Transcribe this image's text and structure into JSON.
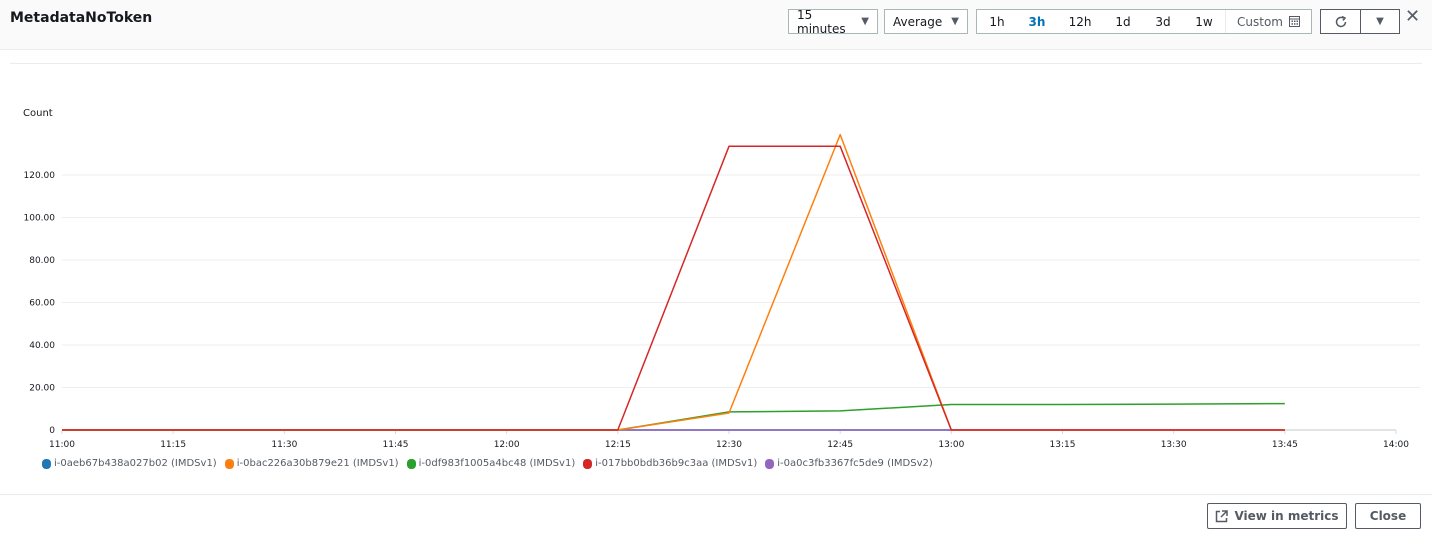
{
  "header": {
    "title": "MetadataNoToken",
    "period": "15 minutes",
    "statistic": "Average",
    "ranges": [
      "1h",
      "3h",
      "12h",
      "1d",
      "3d",
      "1w"
    ],
    "active_range": "3h",
    "custom_label": "Custom",
    "icons": {
      "calendar": "calendar-icon",
      "refresh": "refresh-icon",
      "dropdown": "chevron-down-icon",
      "close": "close-icon"
    }
  },
  "footer": {
    "view_in_metrics": "View in metrics",
    "close": "Close"
  },
  "chart_data": {
    "type": "line",
    "title": "",
    "ylabel": "Count",
    "xlabel": "",
    "ylim": [
      0,
      140
    ],
    "yticks": [
      0,
      20,
      40,
      60,
      80,
      100,
      120
    ],
    "ytick_labels": [
      "0",
      "20.00",
      "40.00",
      "60.00",
      "80.00",
      "100.00",
      "120.00"
    ],
    "x": [
      "11:00",
      "11:15",
      "11:30",
      "11:45",
      "12:00",
      "12:15",
      "12:30",
      "12:45",
      "13:00",
      "13:15",
      "13:30",
      "13:45"
    ],
    "xtick_labels": [
      "11:00",
      "11:15",
      "11:30",
      "11:45",
      "12:00",
      "12:15",
      "12:30",
      "12:45",
      "13:00",
      "13:15",
      "13:30",
      "13:45",
      "14:00"
    ],
    "grid": true,
    "legend_position": "bottom-left",
    "series": [
      {
        "name": "i-0aeb67b438a027b02 (IMDSv1)",
        "color": "#1f77b4",
        "values": [
          0,
          0,
          0,
          0,
          0,
          0,
          0,
          0,
          0,
          0,
          0,
          0
        ]
      },
      {
        "name": "i-0bac226a30b879e21 (IMDSv1)",
        "color": "#ff7f0e",
        "values": [
          0,
          0,
          0,
          0,
          0,
          0,
          8,
          139,
          0,
          0,
          0,
          0
        ]
      },
      {
        "name": "i-0df983f1005a4bc48 (IMDSv1)",
        "color": "#2ca02c",
        "values": [
          0,
          0,
          0,
          0,
          0,
          0,
          8.5,
          9,
          12,
          12,
          12.2,
          12.4
        ]
      },
      {
        "name": "i-017bb0bdb36b9c3aa (IMDSv1)",
        "color": "#d62728",
        "values": [
          0,
          0,
          0,
          0,
          0,
          0,
          133.5,
          133.5,
          0,
          0,
          0,
          0
        ]
      },
      {
        "name": "i-0a0c3fb3367fc5de9 (IMDSv2)",
        "color": "#9467bd",
        "values": [
          0,
          0,
          0,
          0,
          0,
          0,
          0,
          0,
          0,
          0,
          0,
          0
        ]
      }
    ]
  }
}
